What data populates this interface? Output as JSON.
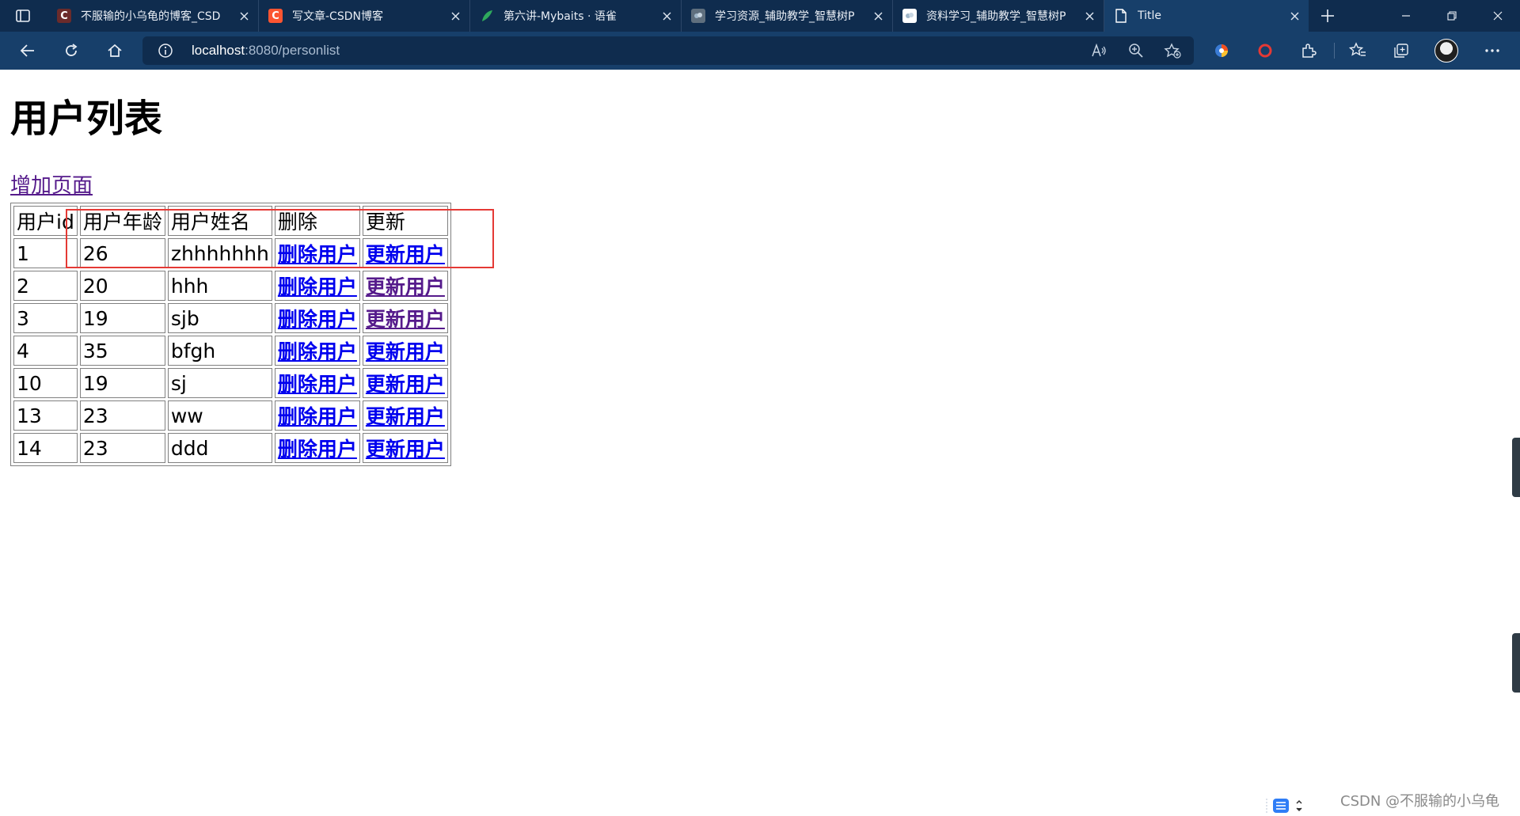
{
  "browser": {
    "tabs": [
      {
        "title": "不服输的小乌龟的博客_CSD",
        "favicon": "csdn-icon",
        "favicon_color": "#6b2b2b",
        "active": false
      },
      {
        "title": "写文章-CSDN博客",
        "favicon": "csdn-icon",
        "favicon_color": "#fc5531",
        "active": false
      },
      {
        "title": "第六讲-Mybaits · 语雀",
        "favicon": "yuque-icon",
        "favicon_color": "#2faa5d",
        "active": false
      },
      {
        "title": "学习资源_辅助教学_智慧树P",
        "favicon": "zhihuishu-icon",
        "favicon_color": "#5f6f7e",
        "active": false
      },
      {
        "title": "资料学习_辅助教学_智慧树P",
        "favicon": "zhihuishu-icon",
        "favicon_color": "#ffffff",
        "active": false
      },
      {
        "title": "Title",
        "favicon": "page-icon",
        "favicon_color": "#ffffff",
        "active": true
      }
    ],
    "favicon_letter": "C",
    "address": {
      "host": "localhost",
      "path": ":8080/personlist"
    },
    "colors": {
      "tabbar": "#0f2c4e",
      "toolbar": "#173f6a"
    }
  },
  "page": {
    "title": "用户列表",
    "add_link": "增加页面",
    "table": {
      "headers": [
        "用户id",
        "用户年龄",
        "用户姓名",
        "删除",
        "更新"
      ],
      "delete_label": "删除用户",
      "update_label": "更新用户",
      "rows": [
        {
          "id": "1",
          "age": "26",
          "name": "zhhhhhhh",
          "update_visited": false
        },
        {
          "id": "2",
          "age": "20",
          "name": "hhh",
          "update_visited": true
        },
        {
          "id": "3",
          "age": "19",
          "name": "sjb",
          "update_visited": true
        },
        {
          "id": "4",
          "age": "35",
          "name": "bfgh",
          "update_visited": false
        },
        {
          "id": "10",
          "age": "19",
          "name": "sj",
          "update_visited": false
        },
        {
          "id": "13",
          "age": "23",
          "name": "ww",
          "update_visited": false
        },
        {
          "id": "14",
          "age": "23",
          "name": "ddd",
          "update_visited": false
        }
      ]
    },
    "highlight_color": "#e53935"
  },
  "watermark": "CSDN @不服输的小乌龟",
  "link_colors": {
    "unvisited": "#0000ee",
    "visited": "#551a8b"
  }
}
